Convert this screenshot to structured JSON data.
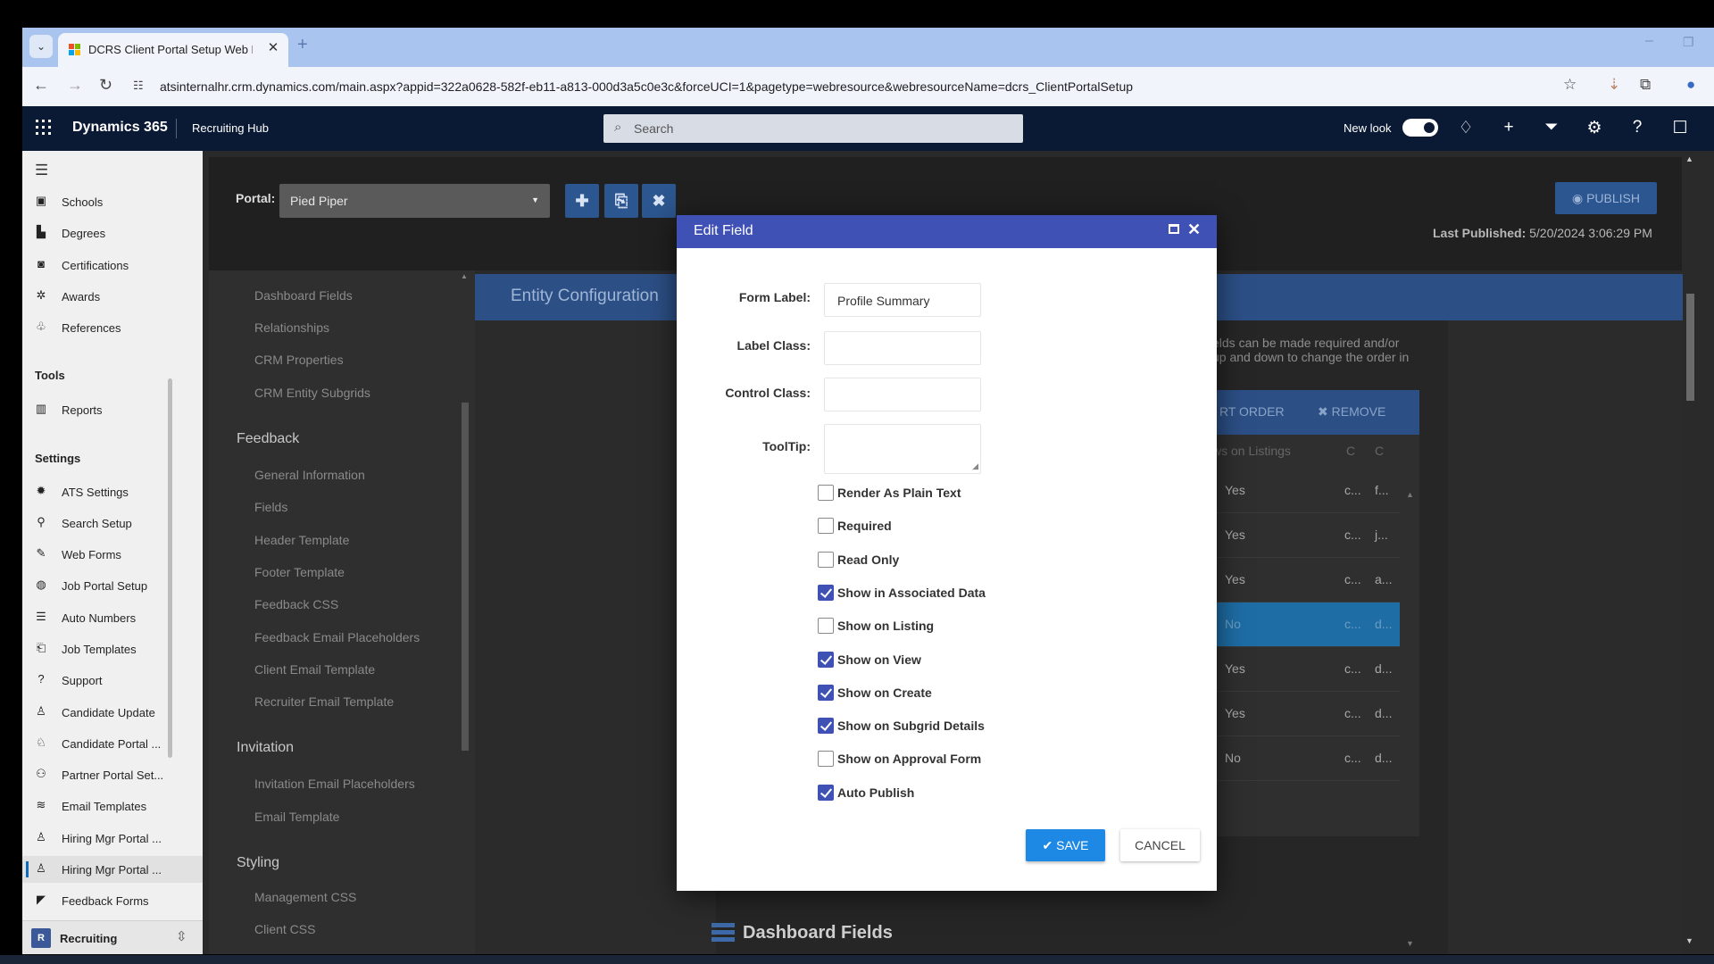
{
  "browser": {
    "tab_title": "DCRS Client Portal Setup Web R",
    "url": "atsinternalhr.crm.dynamics.com/main.aspx?appid=322a0628-582f-eb11-a813-000d3a5c0e3c&forceUCI=1&pagetype=webresource&webresourceName=dcrs_ClientPortalSetup"
  },
  "header": {
    "app_title": "Dynamics 365",
    "area_name": "Recruiting Hub",
    "search_placeholder": "Search",
    "new_look_label": "New look"
  },
  "sitemap": {
    "items_top": [
      {
        "label": "Schools",
        "icon": "abc-icon"
      },
      {
        "label": "Degrees",
        "icon": "degree-icon"
      },
      {
        "label": "Certifications",
        "icon": "certificate-icon"
      },
      {
        "label": "Awards",
        "icon": "award-icon"
      },
      {
        "label": "References",
        "icon": "references-icon"
      }
    ],
    "group_tools": "Tools",
    "tools_items": [
      {
        "label": "Reports",
        "icon": "reports-icon"
      }
    ],
    "group_settings": "Settings",
    "settings_items": [
      {
        "label": "ATS Settings",
        "icon": "gear-icon"
      },
      {
        "label": "Search Setup",
        "icon": "search-setup-icon"
      },
      {
        "label": "Web Forms",
        "icon": "web-form-icon"
      },
      {
        "label": "Job Portal Setup",
        "icon": "globe-icon"
      },
      {
        "label": "Auto Numbers",
        "icon": "numbered-list-icon"
      },
      {
        "label": "Job Templates",
        "icon": "template-icon"
      },
      {
        "label": "Support",
        "icon": "help-circle-icon"
      },
      {
        "label": "Candidate Update",
        "icon": "person-icon"
      },
      {
        "label": "Candidate Portal ...",
        "icon": "people-icon"
      },
      {
        "label": "Partner Portal Set...",
        "icon": "partner-icon"
      },
      {
        "label": "Email Templates",
        "icon": "stack-icon"
      },
      {
        "label": "Hiring Mgr Portal ...",
        "icon": "person-icon"
      },
      {
        "label": "Hiring Mgr Portal ...",
        "icon": "person-icon",
        "selected": true
      },
      {
        "label": "Feedback Forms",
        "icon": "megaphone-icon"
      }
    ],
    "area_switcher": {
      "avatar": "R",
      "label": "Recruiting"
    }
  },
  "portal_bar": {
    "label": "Portal:",
    "selected_portal": "Pied Piper",
    "publish_label": "PUBLISH",
    "last_published_label": "Last Published:",
    "last_published_value": "5/20/2024 3:06:29 PM"
  },
  "config_nav": {
    "items_top": [
      "Dashboard Fields",
      "Relationships",
      "CRM Properties",
      "CRM Entity Subgrids"
    ],
    "group_feedback": "Feedback",
    "feedback_items": [
      "General Information",
      "Fields",
      "Header Template",
      "Footer Template",
      "Feedback CSS",
      "Feedback Email Placeholders",
      "Client Email Template",
      "Recruiter Email Template"
    ],
    "group_invitation": "Invitation",
    "invitation_items": [
      "Invitation Email Placeholders",
      "Email Template"
    ],
    "group_styling": "Styling",
    "styling_items": [
      "Management CSS",
      "Client CSS"
    ]
  },
  "entity": {
    "title": "Entity Configuration",
    "help_line1": "elds can be made required and/or",
    "help_line2": "up and down to change the order in",
    "sort_order_label": "RT ORDER",
    "remove_label": "REMOVE",
    "grid_header": {
      "col1": "ws on Listings",
      "col2": "C",
      "col3": "C"
    },
    "grid_rows": [
      {
        "v": "Yes",
        "c1": "c...",
        "c2": "f..."
      },
      {
        "v": "Yes",
        "c1": "c...",
        "c2": "j..."
      },
      {
        "v": "Yes",
        "c1": "c...",
        "c2": "a..."
      },
      {
        "v": "No",
        "c1": "c...",
        "c2": "d...",
        "selected": true
      },
      {
        "v": "Yes",
        "c1": "c...",
        "c2": "d..."
      },
      {
        "v": "Yes",
        "c1": "c...",
        "c2": "d..."
      },
      {
        "v": "No",
        "c1": "c...",
        "c2": "d..."
      }
    ],
    "dashboard_fields_title": "Dashboard Fields"
  },
  "modal": {
    "title": "Edit Field",
    "form_label_label": "Form Label:",
    "form_label_value": "Profile Summary",
    "label_class_label": "Label Class:",
    "label_class_value": "",
    "control_class_label": "Control Class:",
    "control_class_value": "",
    "tooltip_label": "ToolTip:",
    "tooltip_value": "",
    "checkboxes": [
      {
        "label": "Render As Plain Text",
        "checked": false
      },
      {
        "label": "Required",
        "checked": false
      },
      {
        "label": "Read Only",
        "checked": false
      },
      {
        "label": "Show in Associated Data",
        "checked": true
      },
      {
        "label": "Show on Listing",
        "checked": false
      },
      {
        "label": "Show on View",
        "checked": true
      },
      {
        "label": "Show on Create",
        "checked": true
      },
      {
        "label": "Show on Subgrid Details",
        "checked": true
      },
      {
        "label": "Show on Approval Form",
        "checked": false
      },
      {
        "label": "Auto Publish",
        "checked": true
      }
    ],
    "save_label": "✔ SAVE",
    "cancel_label": "CANCEL"
  }
}
